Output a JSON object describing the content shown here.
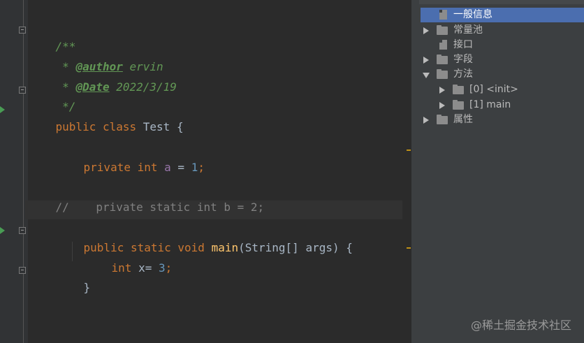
{
  "editor": {
    "doc_open": "/**",
    "doc_author_prefix": " * ",
    "doc_author_tag": "@author",
    "doc_author_value": " ervin",
    "doc_date_prefix": " * ",
    "doc_date_tag": "@Date",
    "doc_date_value": " 2022/3/19",
    "doc_close": " */",
    "class_kw1": "public",
    "class_kw2": "class",
    "class_name": " Test {",
    "field_kw1": "private",
    "field_kw2": "int",
    "field_name": " a",
    "field_eq": " = ",
    "field_value": "1",
    "field_semi": ";",
    "commented_line": "//    private static int b = 2;",
    "method_kw1": "public",
    "method_kw2": "static",
    "method_kw3": "void",
    "method_name": "main",
    "method_params": "(String[] args) {",
    "local_kw": "int",
    "local_name": " x",
    "local_eq": "= ",
    "local_value": "3",
    "local_semi": ";",
    "method_close": "}",
    "class_close": "}"
  },
  "tree": {
    "items": [
      {
        "label": "一般信息",
        "icon": "file-icon",
        "selected": true
      },
      {
        "label": "常量池",
        "icon": "folder-icon",
        "expanded": false
      },
      {
        "label": "接口",
        "icon": "file-icon"
      },
      {
        "label": "字段",
        "icon": "folder-icon",
        "expanded": false
      },
      {
        "label": "方法",
        "icon": "folder-icon",
        "expanded": true
      },
      {
        "label": "[0] <init>",
        "icon": "folder-icon",
        "expanded": false
      },
      {
        "label": "[1] main",
        "icon": "folder-icon",
        "expanded": false
      },
      {
        "label": "属性",
        "icon": "folder-icon",
        "expanded": false
      }
    ]
  },
  "watermark": "@稀土掘金技术社区",
  "colors": {
    "background": "#2b2b2b",
    "keyword": "#cc7832",
    "number": "#6897bb",
    "method": "#ffc66d",
    "doc": "#629755",
    "selection": "#4b6eaf"
  }
}
